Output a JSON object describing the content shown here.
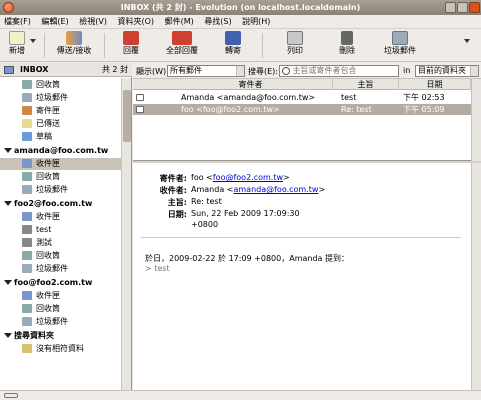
{
  "window": {
    "title": "INBOX (共 2 封) - Evolution (on localhost.localdomain)"
  },
  "menu": [
    "檔案(F)",
    "編輯(E)",
    "檢視(V)",
    "資料夾(O)",
    "郵件(M)",
    "尋找(S)",
    "說明(H)"
  ],
  "toolbar": {
    "new": "新增",
    "send_receive": "傳送/接收",
    "reply": "回覆",
    "reply_all": "全部回覆",
    "forward": "轉寄",
    "print": "列印",
    "delete": "刪除",
    "junk": "垃圾郵件"
  },
  "sidebar": {
    "header": {
      "title": "INBOX",
      "count": "共 2 封"
    },
    "local": [
      {
        "label": "回收筒"
      },
      {
        "label": "垃圾郵件"
      },
      {
        "label": "寄件匣"
      },
      {
        "label": "已傳送"
      },
      {
        "label": "草稿"
      }
    ],
    "accounts": [
      {
        "name": "amanda@foo.com.tw",
        "folders": [
          "收件匣",
          "回收筒",
          "垃圾郵件"
        ]
      },
      {
        "name": "foo2@foo.com.tw",
        "folders": [
          "收件匣",
          "test",
          "測試",
          "回收筒",
          "垃圾郵件"
        ]
      },
      {
        "name": "foo@foo2.com.tw",
        "folders": [
          "收件匣",
          "回收筒",
          "垃圾郵件"
        ]
      },
      {
        "name": "搜尋資料夾",
        "folders": [
          "沒有相符資料"
        ]
      }
    ]
  },
  "searchbar": {
    "show_label": "顯示(W):",
    "show_value": "所有郵件",
    "search_label": "搜尋(E):",
    "search_placeholder": "主旨或寄件者包含",
    "in_label": "in",
    "scope_value": "目前的資料夾"
  },
  "message_list": {
    "columns": [
      "寄件者",
      "主旨",
      "日期"
    ],
    "rows": [
      {
        "from": "Amanda <amanda@foo.com.tw>",
        "subject": "test",
        "date": "下午 02:53",
        "selected": false
      },
      {
        "from": "foo <foo@foo2.com.tw>",
        "subject": "Re: test",
        "date": "下午 05:09",
        "selected": true
      }
    ]
  },
  "preview": {
    "from_label": "寄件者:",
    "from_name": "foo <",
    "from_email": "foo@foo2.com.tw",
    "from_tail": ">",
    "to_label": "收件者:",
    "to_name": "Amanda <",
    "to_email": "amanda@foo.com.tw",
    "to_tail": ">",
    "subject_label": "主旨:",
    "subject": "Re: test",
    "date_label": "日期:",
    "date": "Sun, 22 Feb 2009 17:09:30",
    "date_tz": "+0800",
    "body_line1": "於日，2009-02-22 於 17:09 +0800，Amanda 提到：",
    "body_quote": "> test"
  },
  "colors": {
    "accent": "#d9531e",
    "selection": "#b4aca0",
    "link": "#0000d0"
  }
}
